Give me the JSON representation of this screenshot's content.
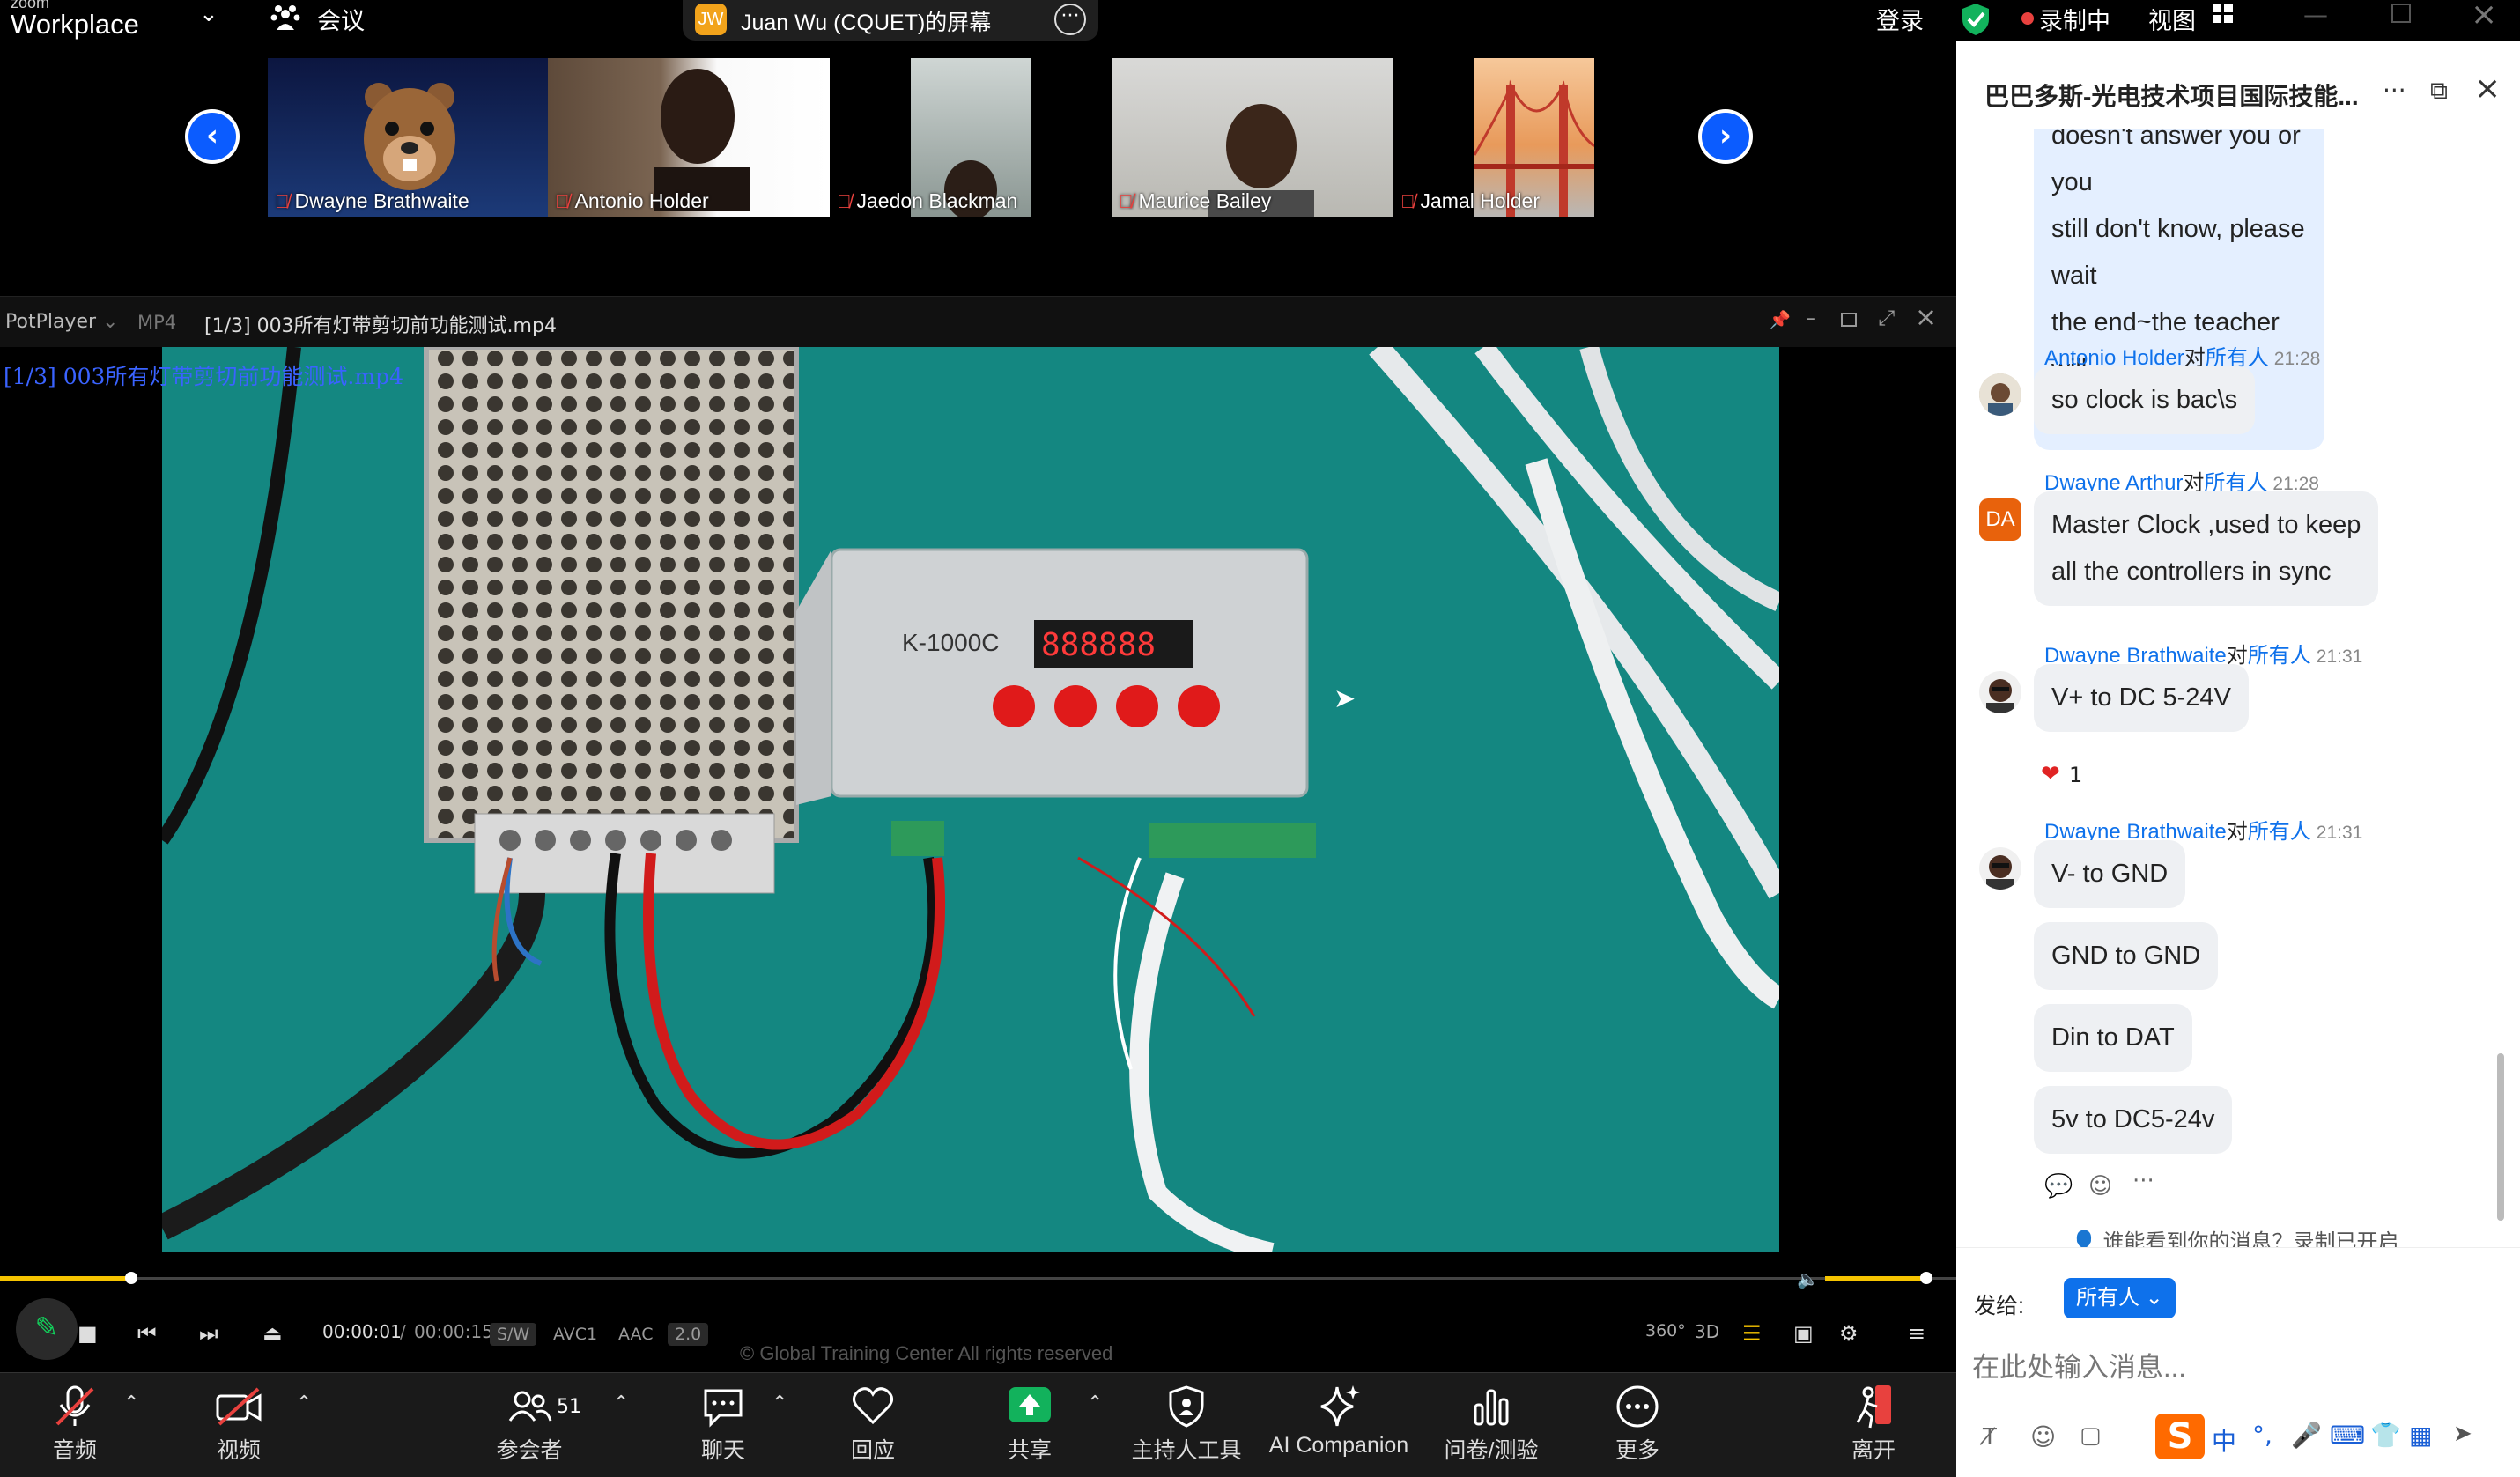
{
  "topbar": {
    "brand_top": "zoom",
    "brand": "Workplace",
    "meetings_label": "会议",
    "share_title": "Juan Wu (CQUET)的屏幕",
    "share_initials": "JW",
    "login": "登录",
    "recording": "录制中",
    "view": "视图"
  },
  "gallery": {
    "participants": [
      {
        "name": "Dwayne Brathwaite"
      },
      {
        "name": "Antonio Holder"
      },
      {
        "name": "Jaedon Blackman"
      },
      {
        "name": "Maurice Bailey"
      },
      {
        "name": "Jamal Holder"
      }
    ]
  },
  "player": {
    "app": "PotPlayer",
    "format": "MP4",
    "title": "[1/3] 003所有灯带剪切前功能测试.mp4",
    "osd": "[1/3] 003所有灯带剪切前功能测试.mp4",
    "time_current": "00:00:01",
    "time_sep": "/",
    "time_total": "00:00:15",
    "tags": [
      "S/W",
      "AVC1",
      "AAC",
      "2.0"
    ],
    "btn_360": "360°",
    "btn_3d": "3D",
    "device_label": "K-1000C",
    "device_display": "888888",
    "progress_fraction": 0.067,
    "volume_fraction": 1.0,
    "watermark": "© Global Training Center All rights reserved"
  },
  "toolbar": {
    "audio": "音频",
    "video": "视频",
    "participants": "参会者",
    "participants_count": "51",
    "chat": "聊天",
    "react": "回应",
    "share": "共享",
    "host_tools": "主持人工具",
    "ai": "AI Companion",
    "polls": "问卷/测验",
    "more": "更多",
    "leave": "离开"
  },
  "chat": {
    "title": "巴巴多斯-光电技术项目国际技能...",
    "self_message_lines": [
      "doesn't answer you or you",
      "still don't know, please wait",
      "the end~the teacher will",
      "answer you again"
    ],
    "messages": [
      {
        "sender": "Antonio Holder",
        "to": "对",
        "group": "所有人",
        "time": "21:28",
        "lines": [
          "so clock is bac\\s"
        ]
      },
      {
        "sender": "Dwayne Arthur",
        "to": "对",
        "group": "所有人",
        "time": "21:28",
        "avatar": "DA",
        "lines": [
          "Master Clock ,used to keep",
          "all the controllers in sync"
        ]
      },
      {
        "sender": "Dwayne Brathwaite",
        "to": "对",
        "group": "所有人",
        "time": "21:31",
        "lines": [
          "V+  to DC 5-24V"
        ],
        "reaction": "1"
      },
      {
        "sender": "Dwayne Brathwaite",
        "to": "对",
        "group": "所有人",
        "time": "21:31",
        "lines": [
          "V-  to GND"
        ]
      }
    ],
    "followups": [
      "GND to GND",
      "Din to DAT",
      "5v to DC5-24v"
    ],
    "privacy_note": "谁能看到你的消息？录制已开启",
    "send_to_label": "发给:",
    "send_to_value": "所有人",
    "input_placeholder": "在此处输入消息..."
  },
  "colors": {
    "accent": "#0b5cff",
    "record": "#e8413e",
    "share_green": "#12b25c"
  }
}
